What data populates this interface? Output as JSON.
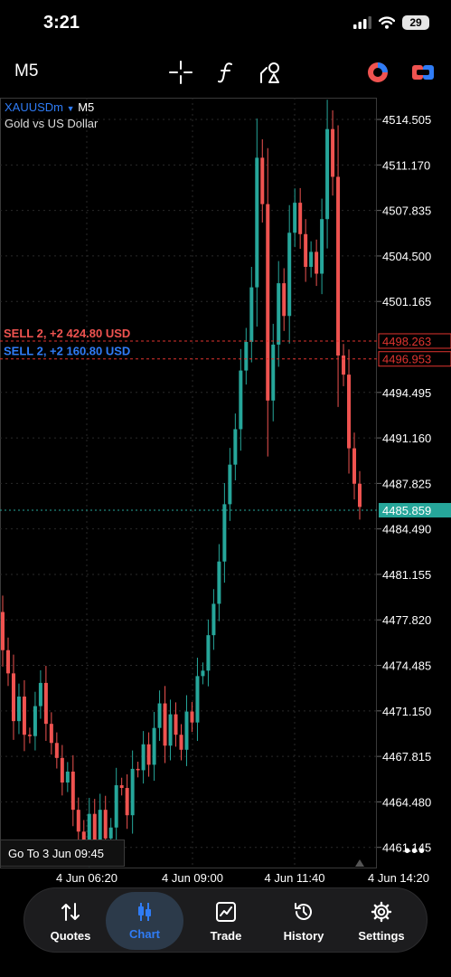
{
  "status": {
    "time": "3:21",
    "battery": "29"
  },
  "toolbar": {
    "timeframe": "M5"
  },
  "chart_header": {
    "symbol": "XAUUSDm",
    "timeframe": "M5",
    "description": "Gold vs US Dollar"
  },
  "colors": {
    "bull": "#26a69a",
    "bear": "#ef5350",
    "accent": "#2f7cf6",
    "sell_line": "#e0342f",
    "bid_line": "#26a69a"
  },
  "orders": [
    {
      "text": "SELL 2, +2 424.80 USD",
      "price_label": "4498.263",
      "price": 4498.263,
      "color": "#ef5350"
    },
    {
      "text": "SELL 2, +2 160.80 USD",
      "price_label": "4496.953",
      "price": 4496.953,
      "color": "#2f7cf6"
    }
  ],
  "current_price": {
    "label": "4485.859",
    "value": 4485.859
  },
  "chart_data": {
    "type": "candlestick",
    "symbol": "XAUUSDm",
    "timeframe": "M5",
    "yticks": [
      "4514.505",
      "4511.170",
      "4507.835",
      "4504.500",
      "4501.165",
      "4494.495",
      "4491.160",
      "4487.825",
      "4484.490",
      "4481.155",
      "4477.820",
      "4474.485",
      "4471.150",
      "4467.815",
      "4464.480",
      "4461.145"
    ],
    "ylim": [
      4459.6,
      4516.1
    ],
    "xticks": [
      "4 Jun 06:20",
      "4 Jun 09:00",
      "4 Jun 11:40",
      "4 Jun 14:20"
    ],
    "close_series": [
      4475.6,
      4473.9,
      4470.4,
      4472.2,
      4469.4,
      4469.3,
      4471.5,
      4473.2,
      4470.2,
      4468.8,
      4467.7,
      4465.9,
      4466.7,
      4463.9,
      4462.3,
      4460.9,
      4463.6,
      4461.2,
      4463.9,
      4461.8,
      4462.6,
      4465.7,
      4465.5,
      4463.5,
      4466.9,
      4466.8,
      4468.7,
      4467.2,
      4469.9,
      4471.7,
      4468.6,
      4470.9,
      4469.4,
      4468.3,
      4471.1,
      4470.3,
      4473.7,
      4474.1,
      4476.7,
      4479.0,
      4482.1,
      4486.3,
      4489.2,
      4491.8,
      4496.1,
      4498.2,
      4502.2,
      4511.7,
      4508.3,
      4493.9,
      4498.0,
      4502.5,
      4500.1,
      4506.2,
      4508.4,
      4506.1,
      4503.7,
      4504.8,
      4503.2,
      4507.2,
      4513.8,
      4510.3,
      4497.2,
      4495.8,
      4490.4,
      4487.8,
      4486.1
    ],
    "xlabel": "",
    "ylabel": ""
  },
  "goto_label": "Go To 3 Jun 09:45",
  "more_label": "•••",
  "nav": [
    {
      "label": "Quotes",
      "icon": "quotes-arrows-icon"
    },
    {
      "label": "Chart",
      "icon": "candles-icon"
    },
    {
      "label": "Trade",
      "icon": "trade-chart-icon"
    },
    {
      "label": "History",
      "icon": "history-clock-icon"
    },
    {
      "label": "Settings",
      "icon": "gear-icon"
    }
  ]
}
